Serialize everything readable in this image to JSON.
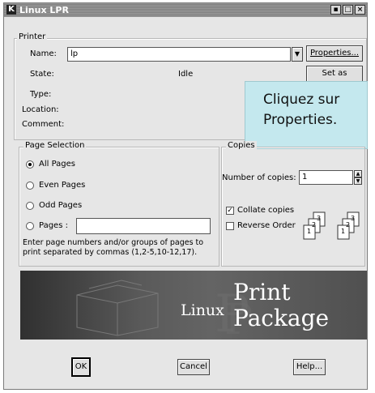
{
  "window": {
    "app_icon": "K",
    "title": "Linux LPR"
  },
  "printer": {
    "group_label": "Printer",
    "name_label": "Name:",
    "name_value": "lp",
    "properties_button": "Properties...",
    "state_label": "State:",
    "state_value": "Idle",
    "set_default_button": "Set as Default",
    "type_label": "Type:",
    "location_label": "Location:",
    "comment_label": "Comment:"
  },
  "callout": {
    "text": "Cliquez sur Properties."
  },
  "page_selection": {
    "group_label": "Page Selection",
    "options": [
      "All Pages",
      "Even Pages",
      "Odd Pages",
      "Pages :"
    ],
    "selected": "All Pages",
    "hint": "Enter page numbers and/or groups of pages to print separated by commas (1,2-5,10-12,17)."
  },
  "copies": {
    "group_label": "Copies",
    "number_label": "Number of copies:",
    "number_value": "1",
    "collate_label": "Collate copies",
    "collate_checked": true,
    "reverse_label": "Reverse Order",
    "reverse_checked": false,
    "page_digits": [
      "3",
      "2",
      "1"
    ]
  },
  "banner": {
    "linux": "Linux",
    "print": "Print",
    "package": "Package"
  },
  "buttons": {
    "ok": "OK",
    "cancel": "Cancel",
    "help": "Help..."
  }
}
